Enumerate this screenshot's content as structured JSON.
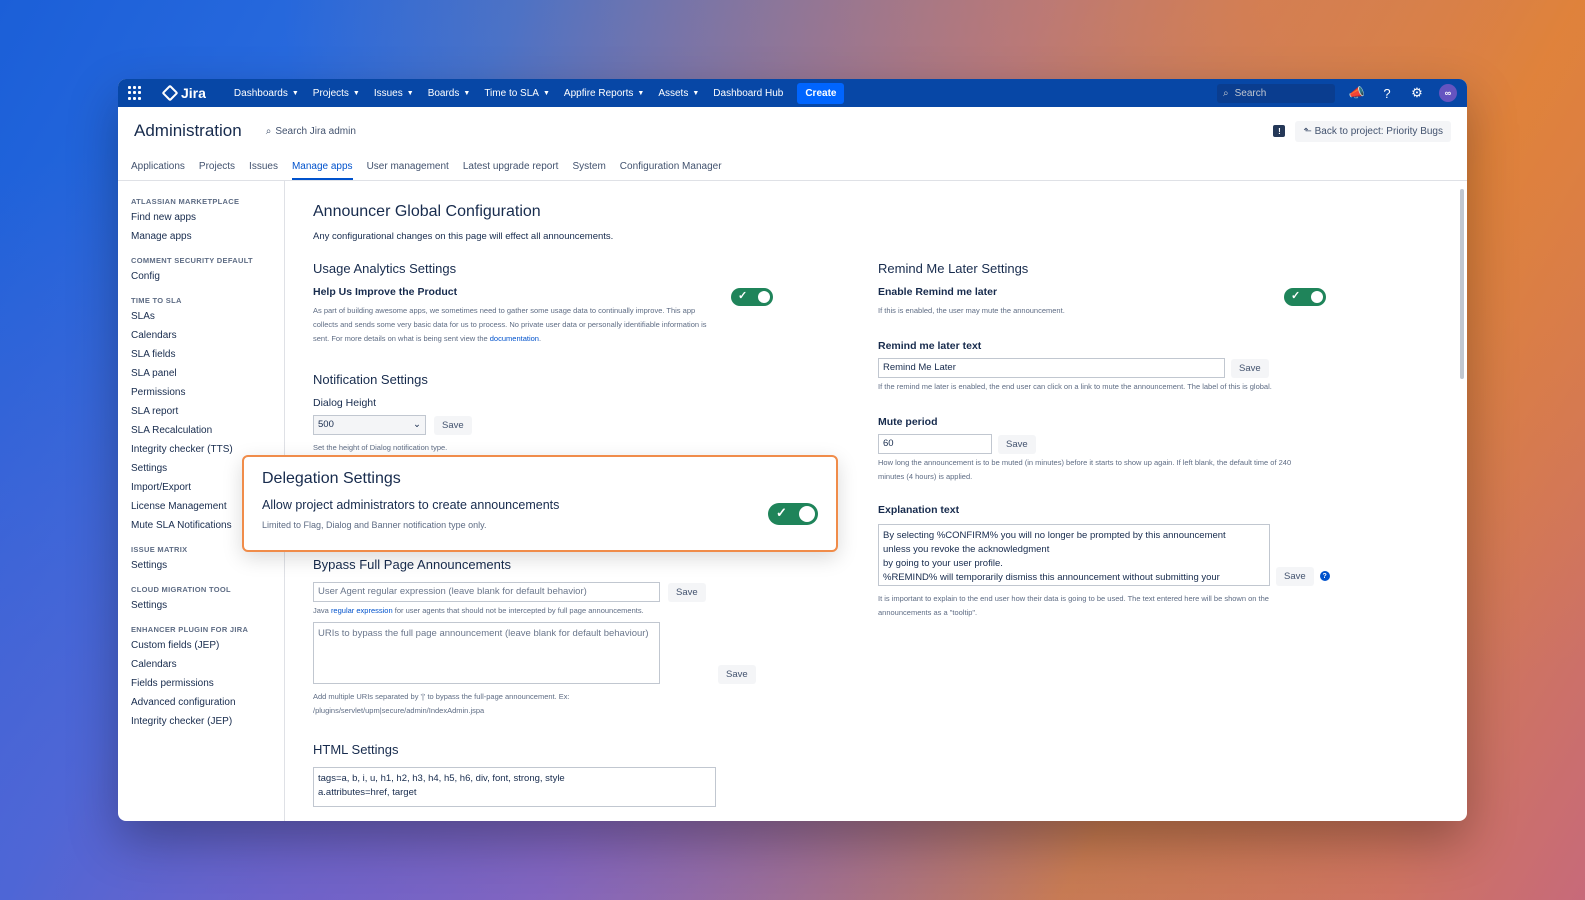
{
  "nav": {
    "logo": "Jira",
    "items": [
      "Dashboards",
      "Projects",
      "Issues",
      "Boards",
      "Time to SLA",
      "Appfire Reports",
      "Assets",
      "Dashboard Hub"
    ],
    "create": "Create",
    "search_placeholder": "Search",
    "avatar_initials": "∞"
  },
  "admin": {
    "title": "Administration",
    "search": "Search Jira admin",
    "back_button": "Back to project: Priority Bugs"
  },
  "tabs": [
    "Applications",
    "Projects",
    "Issues",
    "Manage apps",
    "User management",
    "Latest upgrade report",
    "System",
    "Configuration Manager"
  ],
  "active_tab": "Manage apps",
  "sidebar": [
    {
      "heading": "ATLASSIAN MARKETPLACE",
      "items": [
        "Find new apps",
        "Manage apps"
      ]
    },
    {
      "heading": "COMMENT SECURITY DEFAULT",
      "items": [
        "Config"
      ]
    },
    {
      "heading": "TIME TO SLA",
      "items": [
        "SLAs",
        "Calendars",
        "SLA fields",
        "SLA panel",
        "Permissions",
        "SLA report",
        "SLA Recalculation",
        "Integrity checker (TTS)",
        "Settings",
        "Import/Export",
        "License Management",
        "Mute SLA Notifications"
      ]
    },
    {
      "heading": "ISSUE MATRIX",
      "items": [
        "Settings"
      ]
    },
    {
      "heading": "CLOUD MIGRATION TOOL",
      "items": [
        "Settings"
      ]
    },
    {
      "heading": "ENHANCER PLUGIN FOR JIRA",
      "items": [
        "Custom fields (JEP)",
        "Calendars",
        "Fields permissions",
        "Advanced configuration",
        "Integrity checker (JEP)"
      ]
    }
  ],
  "page": {
    "title": "Announcer Global Configuration",
    "subtitle": "Any configurational changes on this page will effect all announcements."
  },
  "usage": {
    "title": "Usage Analytics Settings",
    "label": "Help Us Improve the Product",
    "desc": "As part of building awesome apps, we sometimes need to gather some usage data to continually improve. This app collects and sends some very basic data for us to process. No private user data or personally identifiable information is sent. For more details on what is being sent view the",
    "link": "documentation",
    "enabled": true
  },
  "notification": {
    "title": "Notification Settings",
    "label": "Dialog Height",
    "value": "500",
    "save": "Save",
    "help": "Set the height of Dialog notification type."
  },
  "delegation": {
    "title": "Delegation Settings",
    "label": "Allow project administrators to create announcements",
    "sub": "Limited to Flag, Dialog and Banner notification type only.",
    "enabled": true
  },
  "bypass": {
    "title": "Bypass Full Page Announcements",
    "ua_placeholder": "User Agent regular expression (leave blank for default behavior)",
    "save": "Save",
    "help_pre": "Java",
    "help_link": "regular expression",
    "help_post": "for user agents that should not be intercepted by full page announcements.",
    "uri_placeholder": "URIs to bypass the full page announcement (leave blank for default behaviour)",
    "uri_help1": "Add multiple URIs separated by '|' to bypass the full-page announcement. Ex:",
    "uri_help2": "/plugins/servlet/upm|secure/admin/IndexAdmin.jspa"
  },
  "html": {
    "title": "HTML Settings",
    "line1": "tags=a, b, i, u, h1, h2, h3, h4, h5, h6, div, font, strong, style",
    "line2": "a.attributes=href, target"
  },
  "remind": {
    "title": "Remind Me Later Settings",
    "label": "Enable Remind me later",
    "help": "If this is enabled, the user may mute the announcement.",
    "enabled": true,
    "text_label": "Remind me later text",
    "text_value": "Remind Me Later",
    "save": "Save",
    "text_help": "If the remind me later is enabled, the end user can click on a link to mute the announcement. The label of this is global."
  },
  "mute": {
    "label": "Mute period",
    "value": "60",
    "save": "Save",
    "help": "How long the announcement is to be muted (in minutes) before it starts to show up again. If left blank, the default time of 240 minutes (4 hours) is applied."
  },
  "explanation": {
    "label": "Explanation text",
    "lines": [
      "By selecting %CONFIRM% you will no longer be prompted by this announcement",
      "unless you revoke the acknowledgment",
      "by going to your user profile.",
      "%REMIND% will temporarily dismiss this announcement without submitting your"
    ],
    "save": "Save",
    "help": "It is important to explain to the end user how their data is going to be used. The text entered here will be shown on the announcements as a \"tooltip\"."
  }
}
